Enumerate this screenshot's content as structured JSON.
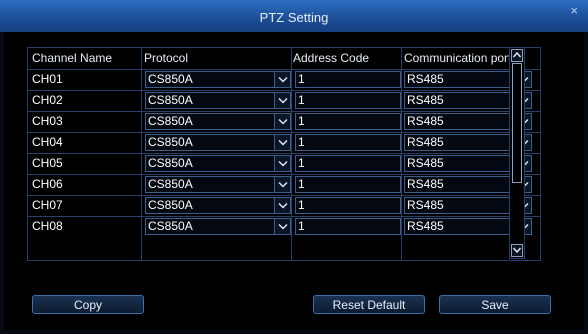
{
  "window": {
    "title": "PTZ Setting",
    "close_glyph": "×"
  },
  "table": {
    "headers": [
      "Channel Name",
      "Protocol",
      "Address Code",
      "Communication port"
    ],
    "rows": [
      {
        "channel": "CH01",
        "protocol": "CS850A",
        "address": "1",
        "port": "RS485"
      },
      {
        "channel": "CH02",
        "protocol": "CS850A",
        "address": "1",
        "port": "RS485"
      },
      {
        "channel": "CH03",
        "protocol": "CS850A",
        "address": "1",
        "port": "RS485"
      },
      {
        "channel": "CH04",
        "protocol": "CS850A",
        "address": "1",
        "port": "RS485"
      },
      {
        "channel": "CH05",
        "protocol": "CS850A",
        "address": "1",
        "port": "RS485"
      },
      {
        "channel": "CH06",
        "protocol": "CS850A",
        "address": "1",
        "port": "RS485"
      },
      {
        "channel": "CH07",
        "protocol": "CS850A",
        "address": "1",
        "port": "RS485"
      },
      {
        "channel": "CH08",
        "protocol": "CS850A",
        "address": "1",
        "port": "RS485"
      }
    ]
  },
  "buttons": {
    "copy": "Copy",
    "reset": "Reset Default",
    "save": "Save"
  },
  "colors": {
    "titlebar": "#1b4d95",
    "grid": "#24406b",
    "background": "#000000"
  }
}
